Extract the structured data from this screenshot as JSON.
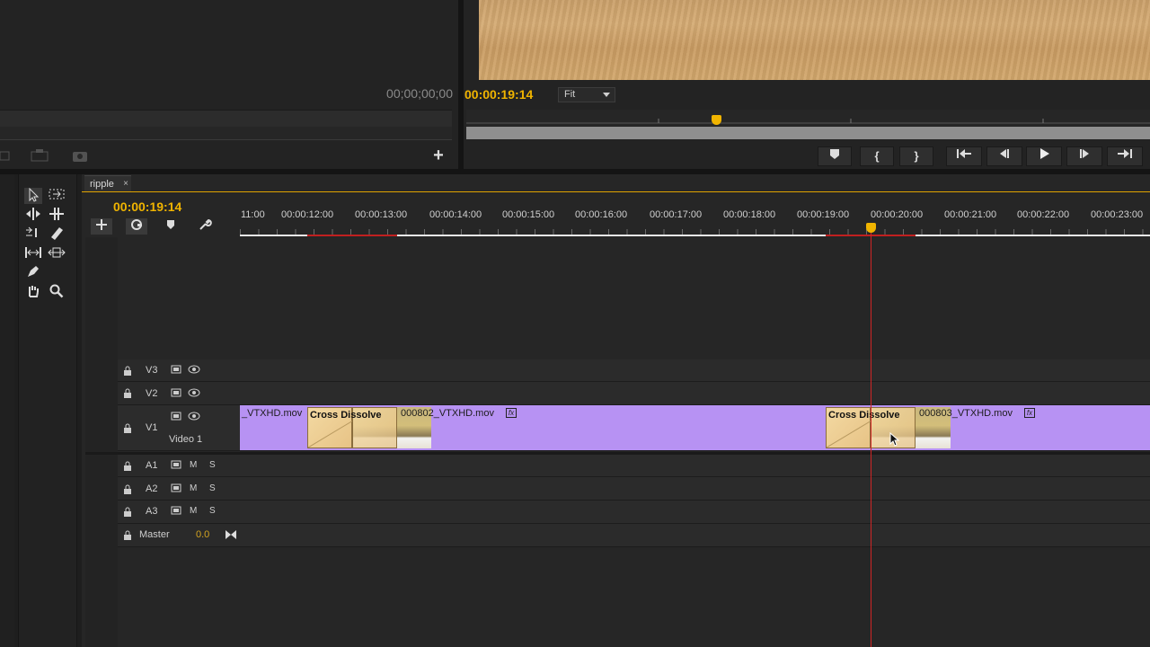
{
  "source_monitor": {
    "timecode": "00;00;00;00"
  },
  "program_monitor": {
    "timecode": "00:00:19:14",
    "zoom": "Fit",
    "buttons": [
      "marker",
      "mark-in",
      "mark-out",
      "go-to-in",
      "step-back",
      "play",
      "step-forward",
      "go-to-out"
    ]
  },
  "timeline": {
    "tab_label": "ripple",
    "tab_close": "×",
    "timecode": "00:00:19:14",
    "ruler_labels": [
      "11:00",
      "00:00:12:00",
      "00:00:13:00",
      "00:00:14:00",
      "00:00:15:00",
      "00:00:16:00",
      "00:00:17:00",
      "00:00:18:00",
      "00:00:19:00",
      "00:00:20:00",
      "00:00:21:00",
      "00:00:22:00",
      "00:00:23:00"
    ],
    "tracks": {
      "v3": "V3",
      "v2": "V2",
      "v1": "V1",
      "v1_name": "Video 1",
      "a1": "A1",
      "a2": "A2",
      "a3": "A3",
      "m": "M",
      "s": "S",
      "master": "Master",
      "master_value": "0.0"
    },
    "clips": {
      "clip1": "_VTXHD.mov",
      "transition1": "Cross Dissolve",
      "clip2": "000802_VTXHD.mov",
      "transition2": "Cross Dissolve",
      "clip3": "000803_VTXHD.mov",
      "fx": "fx"
    }
  },
  "colors": {
    "accent": "#f0b400",
    "clip": "#b792f3",
    "playhead": "#d02525"
  }
}
